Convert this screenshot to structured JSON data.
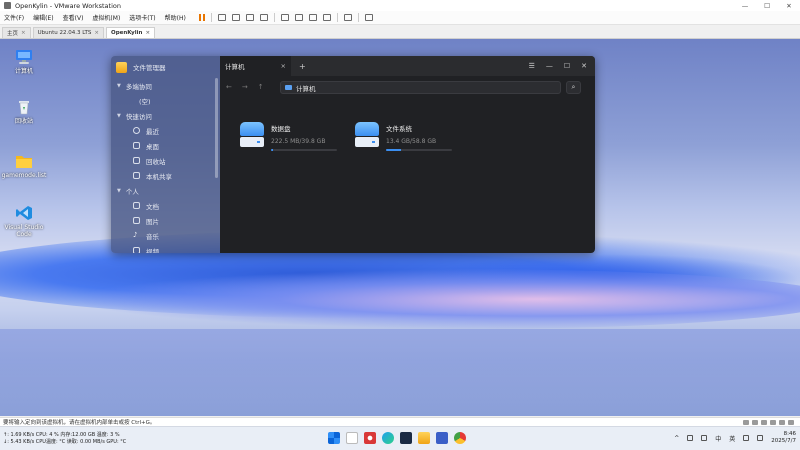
{
  "vmware": {
    "title": "OpenKylin - VMware Workstation",
    "window_controls": [
      "—",
      "☐",
      "✕"
    ],
    "menu": [
      "文件(F)",
      "编辑(E)",
      "查看(V)",
      "虚拟机(M)",
      "选项卡(T)",
      "帮助(H)"
    ],
    "tabs": [
      {
        "label": "主页",
        "close": "×"
      },
      {
        "label": "Ubuntu 22.04.3 LTS",
        "close": "×"
      },
      {
        "label": "OpenKylin",
        "close": "×"
      }
    ],
    "status_text": "要将输入定向到该虚拟机，请在虚拟机内部单击或按 Ctrl+G。"
  },
  "desktop": {
    "icons": [
      {
        "label": "计算机"
      },
      {
        "label": "回收站"
      },
      {
        "label": "gamemode.list"
      },
      {
        "label": "Visual Studio Code"
      }
    ]
  },
  "file_manager": {
    "app_title": "文件管理器",
    "sidebar": {
      "groups": [
        {
          "label": "多端协同",
          "items": [
            {
              "label": "(空)"
            }
          ]
        },
        {
          "label": "快速访问",
          "items": [
            {
              "label": "最近"
            },
            {
              "label": "桌面"
            },
            {
              "label": "回收站"
            },
            {
              "label": "本机共享"
            }
          ]
        },
        {
          "label": "个人",
          "items": [
            {
              "label": "文档"
            },
            {
              "label": "图片"
            },
            {
              "label": "音乐"
            },
            {
              "label": "视频"
            }
          ]
        }
      ]
    },
    "tab_label": "计算机",
    "tab_close": "×",
    "new_tab": "+",
    "controls": [
      "☰",
      "—",
      "☐",
      "✕"
    ],
    "nav": [
      "←",
      "→",
      "↑"
    ],
    "address": "计算机",
    "search_symbol": "⌕",
    "drives": [
      {
        "name": "数据盘",
        "size": "222.5 MB/39.8 GB",
        "used_fraction": 0.01
      },
      {
        "name": "文件系统",
        "size": "13.4 GB/58.8 GB",
        "used_fraction": 0.23
      }
    ]
  },
  "taskbar": {
    "net_line1": "↑: 1.69 KB/s  CPU:  4 %  内存:12.00 GB  温度:  3 %",
    "net_line2": "↓: 5.43 KB/s  CPU温度: °C  读取:  0.00 MB/s  GPU: °C",
    "tray_lang": "中",
    "tray_ime": "英",
    "time": "8:46",
    "date": "2025/7/7",
    "colors": {
      "start": "#0a64d8",
      "accent": "#3b8ef0"
    }
  }
}
